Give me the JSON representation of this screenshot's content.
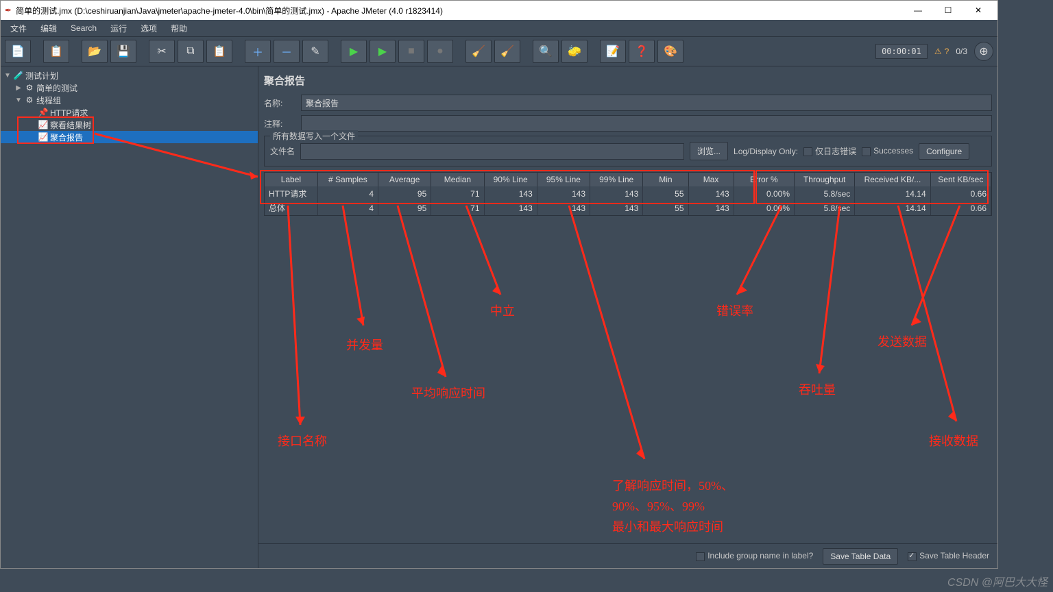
{
  "window": {
    "title": "简单的测试.jmx (D:\\ceshiruanjian\\Java\\jmeter\\apache-jmeter-4.0\\bin\\简单的测试.jmx) - Apache JMeter (4.0 r1823414)",
    "min": "—",
    "max": "☐",
    "close": "✕"
  },
  "menu": {
    "items": [
      "文件",
      "编辑",
      "Search",
      "运行",
      "选项",
      "帮助"
    ]
  },
  "status": {
    "time": "00:00:01",
    "warn_count": "?",
    "threads": "0/3"
  },
  "tree": {
    "n0": {
      "label": "测试计划"
    },
    "n1": {
      "label": "简单的测试"
    },
    "n2": {
      "label": "线程组"
    },
    "n3": {
      "label": "HTTP请求"
    },
    "n4": {
      "label": "察看结果树"
    },
    "n5": {
      "label": "聚合报告"
    }
  },
  "panel": {
    "title": "聚合报告",
    "name_lbl": "名称:",
    "name_val": "聚合报告",
    "comment_lbl": "注释:",
    "comment_val": "",
    "file_legend": "所有数据写入一个文件",
    "file_lbl": "文件名",
    "file_val": "",
    "browse": "浏览...",
    "logonly": "Log/Display Only:",
    "errors_only": "仅日志错误",
    "successes": "Successes",
    "configure": "Configure"
  },
  "table": {
    "headers": [
      "Label",
      "# Samples",
      "Average",
      "Median",
      "90% Line",
      "95% Line",
      "99% Line",
      "Min",
      "Max",
      "Error %",
      "Throughput",
      "Received KB/...",
      "Sent KB/sec"
    ],
    "rows": [
      {
        "c": [
          "HTTP请求",
          "4",
          "95",
          "71",
          "143",
          "143",
          "143",
          "55",
          "143",
          "0.00%",
          "5.8/sec",
          "14.14",
          "0.66"
        ]
      },
      {
        "c": [
          "总体",
          "4",
          "95",
          "71",
          "143",
          "143",
          "143",
          "55",
          "143",
          "0.00%",
          "5.8/sec",
          "14.14",
          "0.66"
        ]
      }
    ]
  },
  "footer": {
    "include_group": "Include group name in label?",
    "save_data": "Save Table Data",
    "save_header": "Save Table Header"
  },
  "ann": {
    "a1": "接口名称",
    "a2": "并发量",
    "a3": "平均响应时间",
    "a4": "中立",
    "a5": "了解响应时间，50%、",
    "a5b": "90%、95%、99%",
    "a5c": "最小和最大响应时间",
    "a6": "错误率",
    "a7": "吞吐量",
    "a8": "发送数据",
    "a9": "接收数据"
  },
  "watermark": "CSDN @阿巴大大怪"
}
